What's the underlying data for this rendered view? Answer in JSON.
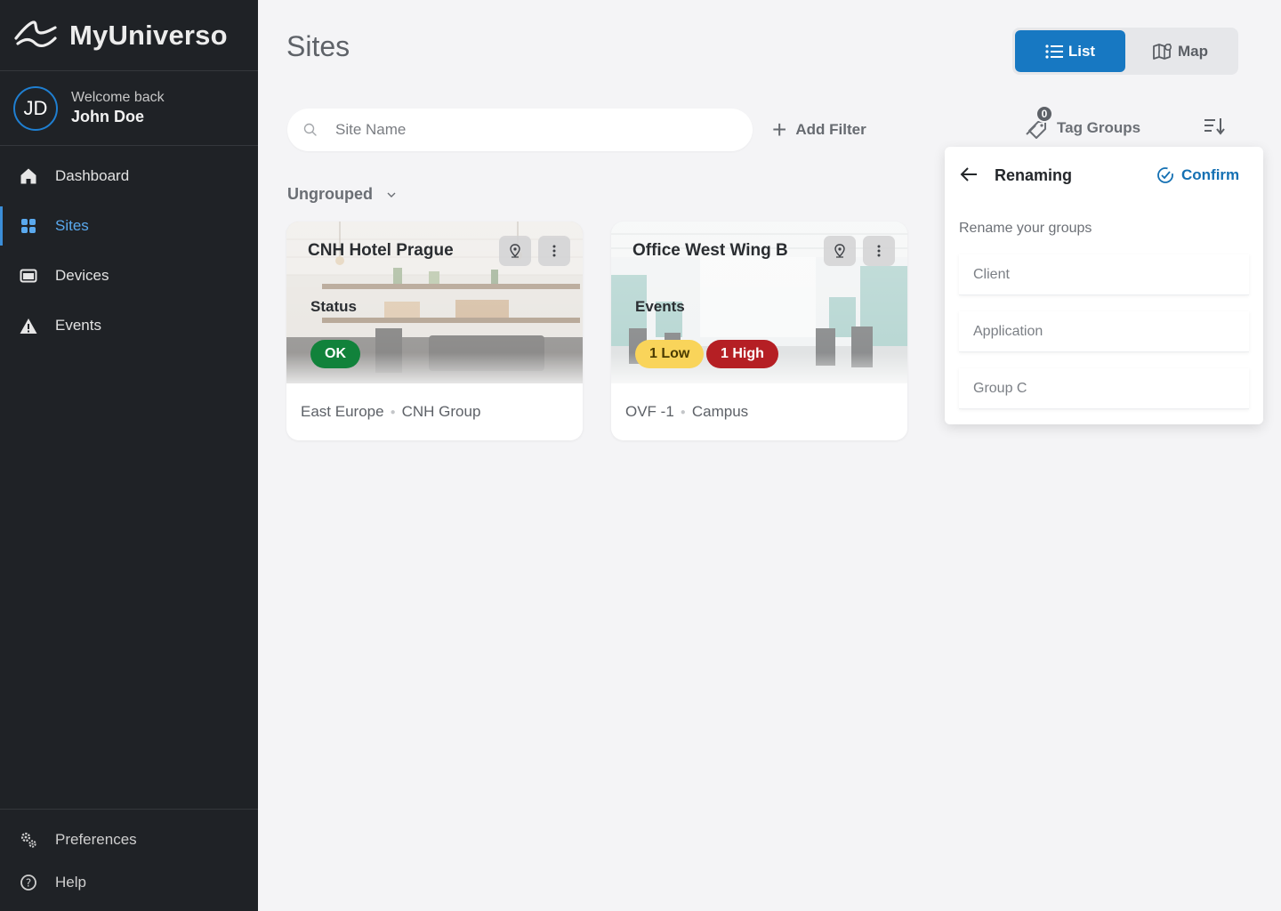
{
  "app": {
    "name": "MyUniverso"
  },
  "user": {
    "initials": "JD",
    "welcome": "Welcome back",
    "name": "John Doe"
  },
  "nav": {
    "items": [
      {
        "label": "Dashboard",
        "icon": "home-icon"
      },
      {
        "label": "Sites",
        "icon": "grid-icon",
        "active": true
      },
      {
        "label": "Devices",
        "icon": "device-icon"
      },
      {
        "label": "Events",
        "icon": "warning-icon"
      }
    ],
    "bottom": [
      {
        "label": "Preferences",
        "icon": "gears-icon"
      },
      {
        "label": "Help",
        "icon": "help-icon"
      }
    ]
  },
  "header": {
    "title": "Sites"
  },
  "view_toggle": {
    "list": "List",
    "map": "Map",
    "active": "list"
  },
  "toolbar": {
    "search_placeholder": "Site Name",
    "add_filter": "Add Filter",
    "tag_groups": "Tag Groups",
    "tag_count": "0"
  },
  "group": {
    "label": "Ungrouped"
  },
  "cards": [
    {
      "title": "CNH Hotel Prague",
      "section_label": "Status",
      "badges": [
        {
          "text": "OK",
          "kind": "ok"
        }
      ],
      "footer": [
        "East Europe",
        "CNH Group"
      ]
    },
    {
      "title": "Office West Wing B",
      "section_label": "Events",
      "badges": [
        {
          "text": "1 Low",
          "kind": "low"
        },
        {
          "text": "1 High",
          "kind": "high"
        }
      ],
      "footer": [
        "OVF -1",
        "Campus"
      ]
    }
  ],
  "renaming": {
    "title": "Renaming",
    "confirm": "Confirm",
    "subtitle": "Rename your groups",
    "fields": [
      {
        "placeholder": "Client"
      },
      {
        "placeholder": "Application"
      },
      {
        "placeholder": "Group C"
      }
    ]
  },
  "colors": {
    "sidebar_bg": "#1f2226",
    "accent": "#1778c2",
    "active_nav": "#5aa9ee",
    "ok": "#11823b",
    "low": "#f9d45a",
    "high": "#b51f24"
  }
}
